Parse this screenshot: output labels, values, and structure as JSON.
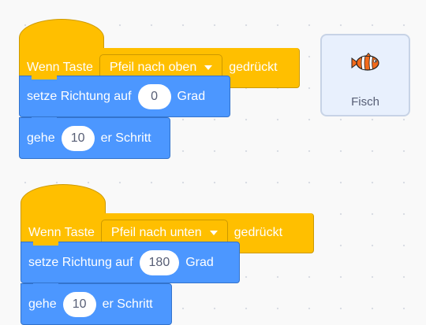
{
  "scripts": [
    {
      "hat": {
        "prefix": "Wenn Taste",
        "key": "Pfeil nach oben",
        "suffix": "gedrückt"
      },
      "direction": {
        "prefix": "setze Richtung auf",
        "value": "0",
        "suffix": "Grad"
      },
      "move": {
        "prefix": "gehe",
        "value": "10",
        "suffix": "er Schritt"
      }
    },
    {
      "hat": {
        "prefix": "Wenn Taste",
        "key": "Pfeil nach unten",
        "suffix": "gedrückt"
      },
      "direction": {
        "prefix": "setze Richtung auf",
        "value": "180",
        "suffix": "Grad"
      },
      "move": {
        "prefix": "gehe",
        "value": "10",
        "suffix": "er Schritt"
      }
    }
  ],
  "sprite": {
    "name": "Fisch",
    "icon": "clownfish-icon"
  },
  "colors": {
    "events": "#ffbf00",
    "events_border": "#cc9900",
    "motion": "#4c97ff",
    "motion_border": "#3373cc",
    "workspace": "#f9f9f9"
  }
}
